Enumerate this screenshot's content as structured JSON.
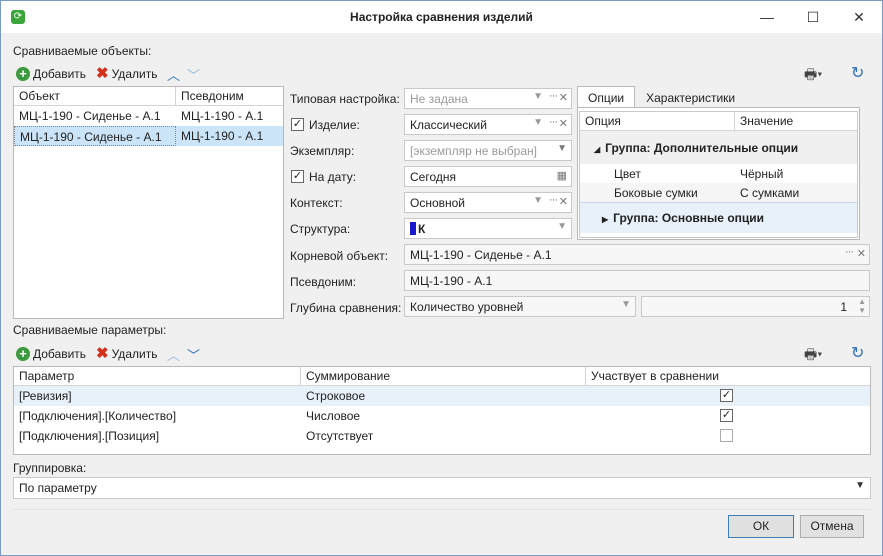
{
  "window": {
    "title": "Настройка сравнения изделий",
    "min_icon": "minimize-icon",
    "max_icon": "maximize-icon",
    "close_icon": "close-icon"
  },
  "objects": {
    "label": "Сравниваемые объекты:",
    "add_label": "Добавить",
    "delete_label": "Удалить",
    "columns": [
      "Объект",
      "Псевдоним"
    ],
    "rows": [
      {
        "object": "МЦ-1-190 - Сиденье - А.1",
        "alias": "МЦ-1-190 - А.1",
        "selected": false
      },
      {
        "object": "МЦ-1-190 - Сиденье - А.1",
        "alias": "МЦ-1-190 - А.1",
        "selected": true
      }
    ]
  },
  "form": {
    "typical_label": "Типовая настройка:",
    "typical_value": "Не задана",
    "product_label": "Изделие:",
    "product_checked": true,
    "product_value": "Классический",
    "instance_label": "Экземпляр:",
    "instance_value": "[экземпляр не выбран]",
    "date_label": "На дату:",
    "date_checked": true,
    "date_value": "Сегодня",
    "context_label": "Контекст:",
    "context_value": "Основной",
    "structure_label": "Структура:",
    "structure_value": "К",
    "structure_color": "#1a1acc",
    "root_label": "Корневой объект:",
    "root_value": "МЦ-1-190 - Сиденье - А.1",
    "alias_label": "Псевдоним:",
    "alias_value": "МЦ-1-190 - А.1",
    "depth_label": "Глубина сравнения:",
    "depth_mode": "Количество уровней",
    "depth_value": "1"
  },
  "options": {
    "tabs": [
      "Опции",
      "Характеристики"
    ],
    "columns": [
      "Опция",
      "Значение"
    ],
    "group1": "Группа: Дополнительные опции",
    "items": [
      {
        "name": "Цвет",
        "value": "Чёрный"
      },
      {
        "name": "Боковые сумки",
        "value": "С сумками"
      }
    ],
    "group2": "Группа: Основные опции"
  },
  "params": {
    "label": "Сравниваемые параметры:",
    "add_label": "Добавить",
    "delete_label": "Удалить",
    "columns": [
      "Параметр",
      "Суммирование",
      "Участвует в сравнении"
    ],
    "rows": [
      {
        "param": "[Ревизия]",
        "sum": "Строковое",
        "checked": true
      },
      {
        "param": "[Подключения].[Количество]",
        "sum": "Числовое",
        "checked": true
      },
      {
        "param": "[Подключения].[Позиция]",
        "sum": "Отсутствует",
        "checked": false
      }
    ]
  },
  "grouping": {
    "label": "Группировка:",
    "value": "По параметру"
  },
  "buttons": {
    "ok": "ОК",
    "cancel": "Отмена"
  }
}
